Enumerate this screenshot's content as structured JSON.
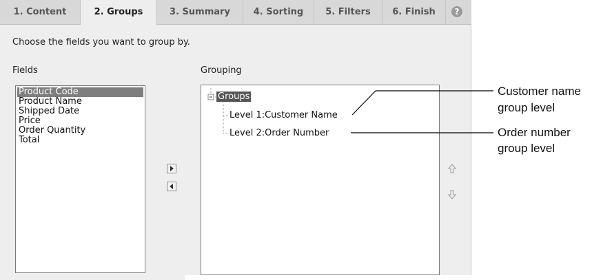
{
  "tabs": [
    {
      "label": "1. Content"
    },
    {
      "label": "2. Groups"
    },
    {
      "label": "3. Summary"
    },
    {
      "label": "4. Sorting"
    },
    {
      "label": "5. Filters"
    },
    {
      "label": "6. Finish"
    }
  ],
  "help_icon": "?",
  "instruction": "Choose the fields you want to group by.",
  "fields": {
    "label": "Fields",
    "items": [
      "Product Code",
      "Product Name",
      "Shipped Date",
      "Price",
      "Order Quantity",
      "Total"
    ],
    "selected": "Product Code"
  },
  "grouping": {
    "label": "Grouping",
    "root": "Groups",
    "levels": [
      "Level 1:Customer Name",
      "Level 2:Order Number"
    ]
  },
  "callouts": {
    "customer_line1": "Customer name",
    "customer_line2": "group level",
    "order_line1": "Order number",
    "order_line2": "group level"
  }
}
